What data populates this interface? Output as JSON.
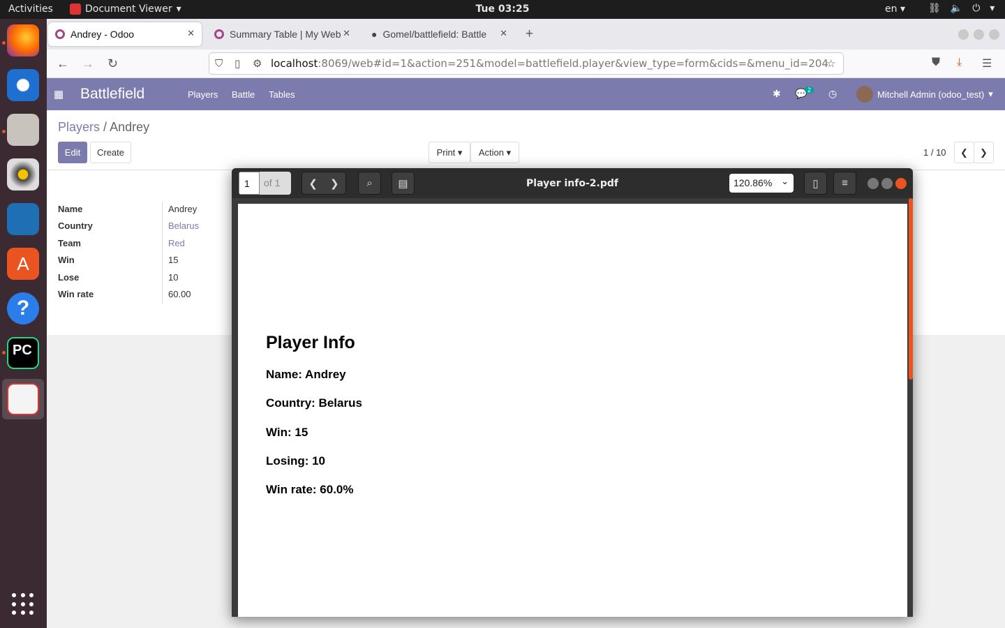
{
  "topbar": {
    "activities": "Activities",
    "app_name": "Document Viewer",
    "clock": "Tue 03:25",
    "lang": "en"
  },
  "browser": {
    "tabs": [
      {
        "title": "Andrey - Odoo"
      },
      {
        "title": "Summary Table | My Web"
      },
      {
        "title": "Gomel/battlefield: Battle"
      }
    ],
    "url_host": "localhost",
    "url_rest": ":8069/web#id=1&action=251&model=battlefield.player&view_type=form&cids=&menu_id=204"
  },
  "odoo": {
    "brand": "Battlefield",
    "menu": [
      "Players",
      "Battle",
      "Tables"
    ],
    "chat_count": "2",
    "user": "Mitchell Admin (odoo_test)",
    "breadcrumb_parent": "Players",
    "breadcrumb_sep": "/",
    "breadcrumb_current": "Andrey",
    "edit": "Edit",
    "create": "Create",
    "print": "Print",
    "action": "Action",
    "pager": "1 / 10",
    "fields": [
      {
        "label": "Name",
        "value": "Andrey"
      },
      {
        "label": "Country",
        "value": "Belarus"
      },
      {
        "label": "Team",
        "value": "Red"
      },
      {
        "label": "Win",
        "value": "15"
      },
      {
        "label": "Lose",
        "value": "10"
      },
      {
        "label": "Win rate",
        "value": "60.00"
      }
    ]
  },
  "viewer": {
    "page_current": "1",
    "page_of": "of 1",
    "title": "Player info-2.pdf",
    "zoom": "120.86%",
    "doc": {
      "heading": "Player Info",
      "lines": [
        "Name: Andrey",
        "Country: Belarus",
        "Win: 15",
        "Losing: 10",
        "Win rate: 60.0%"
      ]
    }
  }
}
